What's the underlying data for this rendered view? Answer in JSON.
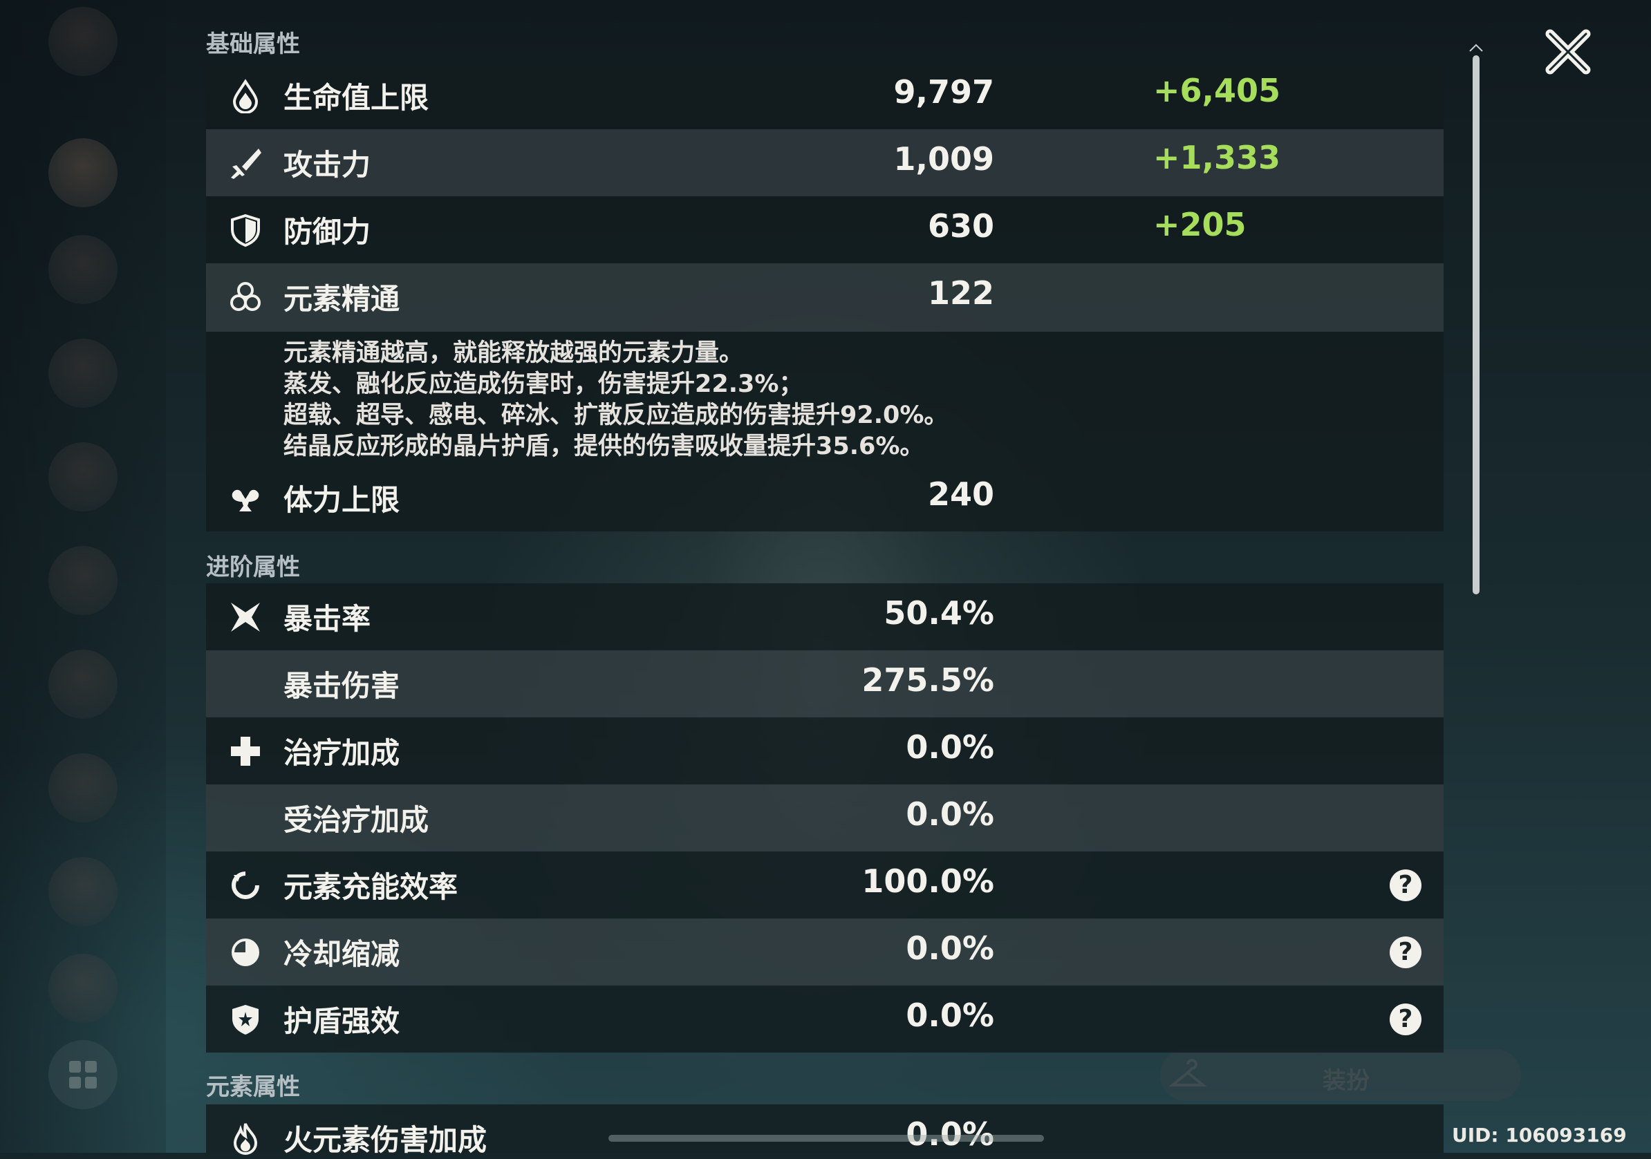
{
  "sections": {
    "basic": "基础属性",
    "advanced": "进阶属性",
    "elemental": "元素属性"
  },
  "stats": {
    "hp": {
      "label": "生命值上限",
      "value": "9,797",
      "bonus": "+6,405",
      "icon": "hp-drop-icon"
    },
    "atk": {
      "label": "攻击力",
      "value": "1,009",
      "bonus": "+1,333",
      "icon": "sword-icon"
    },
    "def": {
      "label": "防御力",
      "value": "630",
      "bonus": "+205",
      "icon": "shield-icon"
    },
    "em": {
      "label": "元素精通",
      "value": "122",
      "icon": "elemental-mastery-icon"
    },
    "stamina": {
      "label": "体力上限",
      "value": "240",
      "icon": "stamina-icon"
    },
    "crit_rate": {
      "label": "暴击率",
      "value": "50.4%",
      "icon": "crit-star-icon"
    },
    "crit_dmg": {
      "label": "暴击伤害",
      "value": "275.5%"
    },
    "healing": {
      "label": "治疗加成",
      "value": "0.0%",
      "icon": "healing-cross-icon"
    },
    "incoming_healing": {
      "label": "受治疗加成",
      "value": "0.0%"
    },
    "energy_recharge": {
      "label": "元素充能效率",
      "value": "100.0%",
      "icon": "energy-recharge-icon",
      "help": "?"
    },
    "cd_reduction": {
      "label": "冷却缩减",
      "value": "0.0%",
      "icon": "cooldown-icon",
      "help": "?"
    },
    "shield_strength": {
      "label": "护盾强效",
      "value": "0.0%",
      "icon": "shield-strength-icon",
      "help": "?"
    },
    "pyro_dmg": {
      "label": "火元素伤害加成",
      "value": "0.0%",
      "icon": "pyro-flame-icon"
    }
  },
  "em_description": [
    "元素精通越高，就能释放越强的元素力量。",
    "蒸发、融化反应造成伤害时，伤害提升22.3%；",
    "超载、超导、感电、碎冰、扩散反应造成的伤害提升92.0%。",
    "结晶反应形成的晶片护盾，提供的伤害吸收量提升35.6%。"
  ],
  "uid": "UID: 106093169",
  "outfit_button": "装扮",
  "colors": {
    "bonus_green": "#a6dd5a",
    "text": "#f3f1ec",
    "row_dark": "#121c1f",
    "row_light": "#323c3f"
  }
}
